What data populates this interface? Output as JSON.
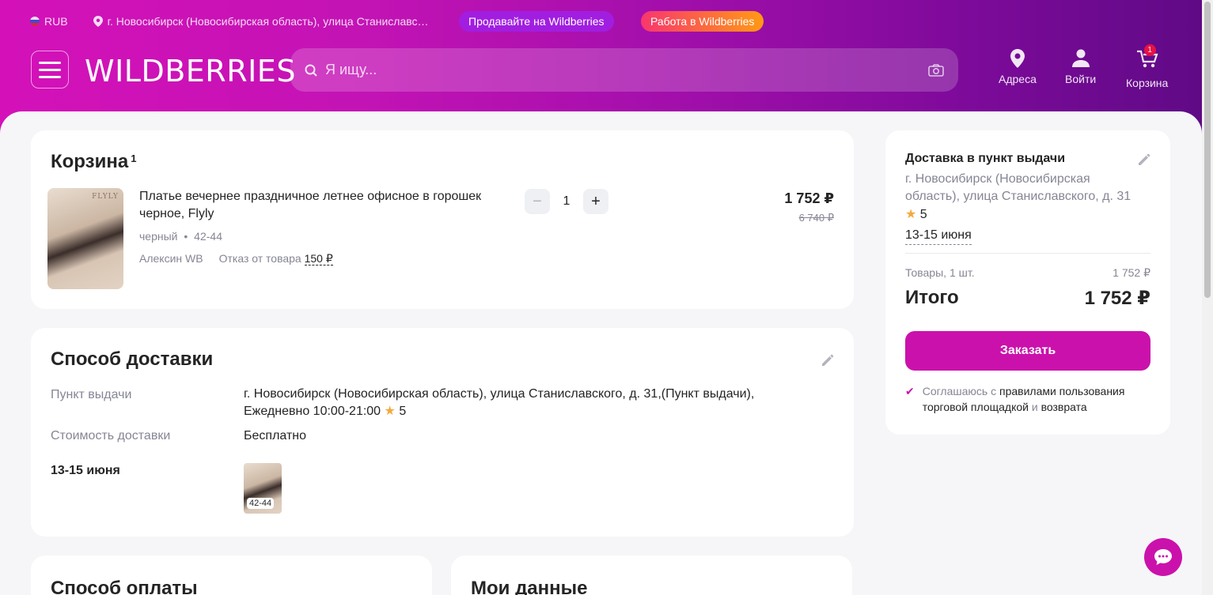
{
  "header": {
    "currency": "RUB",
    "location": "г. Новосибирск (Новосибирская область), улица Станиславс…",
    "sell_label": "Продавайте на Wildberries",
    "work_label": "Работа в Wildberries",
    "logo": "WILDBERRIES",
    "search_placeholder": "Я ищу...",
    "nav": {
      "addresses": "Адреса",
      "login": "Войти",
      "cart": "Корзина",
      "cart_count": "1"
    }
  },
  "cart": {
    "title": "Корзина",
    "count": "1",
    "item": {
      "name": "Платье вечернее праздничное летнее офисное в горошек черное, Flyly",
      "thumb_brand": "FLYLY",
      "color": "черный",
      "size": "42-44",
      "seller": "Алексин WB",
      "refusal_label": "Отказ от товара",
      "refusal_price": "150 ₽",
      "quantity": "1",
      "price": "1 752 ₽",
      "old_price": "6 740 ₽"
    }
  },
  "delivery": {
    "title": "Способ доставки",
    "pickup_label": "Пункт выдачи",
    "pickup_value_1": "г. Новосибирск (Новосибирская область), улица Станиславского, д. 31,(Пункт выдачи),",
    "pickup_value_2": "Ежедневно 10:00-21:00",
    "pickup_rating": "5",
    "cost_label": "Стоимость доставки",
    "cost_value": "Бесплатно",
    "date": "13-15 июня",
    "item_size": "42-44"
  },
  "payment": {
    "title": "Способ оплаты"
  },
  "mydata": {
    "title": "Мои данные"
  },
  "summary": {
    "title": "Доставка в пункт выдачи",
    "address": "г. Новосибирск (Новосибирская область), улица Станиславского, д. 31",
    "rating": "5",
    "date": "13-15 июня",
    "items_label": "Товары, 1 шт.",
    "items_price": "1 752 ₽",
    "total_label": "Итого",
    "total_price": "1 752 ₽",
    "order_button": "Заказать",
    "agree_prefix": "Соглашаюсь с",
    "agree_rules": "правилами пользования торговой площадкой",
    "agree_and": "и",
    "agree_return": "возврата"
  },
  "colors": {
    "brand": "#cb11ab",
    "header_gradient_start": "#d411b8",
    "header_gradient_end": "#5e0a85",
    "star": "#f3a93c"
  },
  "icons": [
    "flag-icon",
    "location-pin-icon",
    "menu-icon",
    "search-icon",
    "camera-icon",
    "address-icon",
    "user-icon",
    "cart-icon",
    "edit-icon",
    "star-icon",
    "check-icon",
    "chat-icon"
  ]
}
